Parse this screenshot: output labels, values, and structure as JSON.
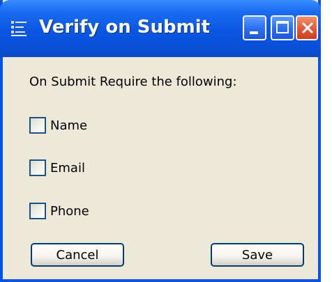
{
  "window": {
    "title": "Verify on Submit",
    "controls": [
      "minimize",
      "maximize",
      "close"
    ]
  },
  "prompt": "On Submit Require the following:",
  "checkboxes": [
    {
      "label": "Name",
      "checked": false
    },
    {
      "label": "Email",
      "checked": false
    },
    {
      "label": "Phone",
      "checked": false
    }
  ],
  "buttons": {
    "cancel": "Cancel",
    "save": "Save"
  },
  "colors": {
    "titlebar": "#0a56e3",
    "window_bg": "#ece9d8",
    "close_button": "#e2583a"
  },
  "icons": {
    "title": "form-list-icon",
    "minimize": "minimize-icon",
    "maximize": "maximize-icon",
    "close": "close-icon"
  }
}
